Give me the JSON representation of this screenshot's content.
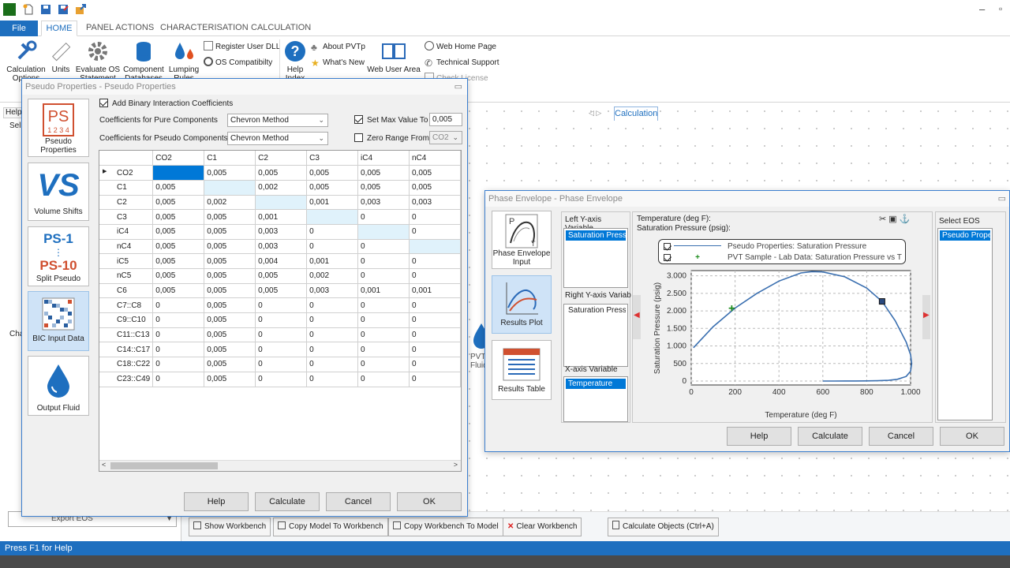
{
  "status_text": "Press F1 for Help",
  "tabs": [
    "File",
    "HOME",
    "PANEL ACTIONS",
    "CHARACTERISATION",
    "CALCULATION"
  ],
  "ribbon": {
    "calc_options": "Calculation Options",
    "units": "Units",
    "evaluate": "Evaluate OS Statement",
    "component_db": "Component Databases",
    "lumping": "Lumping Rules",
    "register_dll": "Register User DLL",
    "os_compat": "OS Compatibilty",
    "help_index": "Help Index",
    "about": "About PVTp",
    "whats_new": "What's New",
    "web_user": "Web User Area",
    "web_home": "Web Home Page",
    "tech_support": "Technical Support",
    "license": "Check License"
  },
  "left_panel": {
    "help_tab": "Help",
    "sel_label": "Sel",
    "cha_label": "Cha",
    "export_eos": "Export EOS"
  },
  "workbench_tab": "Calculation",
  "workbench_buttons": {
    "show": "Show Workbench",
    "copy_model": "Copy Model To Workbench",
    "copy_wb": "Copy Workbench To Model",
    "clear": "Clear Workbench",
    "calc_objects": "Calculate Objects (Ctrl+A)"
  },
  "pseudo_dialog": {
    "title": "Pseudo Properties - Pseudo Properties",
    "sidebar": [
      "Pseudo Properties",
      "Volume Shifts",
      "Split Pseudo",
      "BIC Input Data",
      "Output Fluid"
    ],
    "add_bic": "Add Binary Interaction Coefficients",
    "pure_label": "Coefficients for Pure Components",
    "pure_value": "Chevron Method",
    "pseudo_label": "Coefficients for Pseudo Components",
    "pseudo_value": "Chevron Method",
    "set_max_label": "Set Max Value To",
    "set_max_value": "0,005",
    "zero_range_label": "Zero Range From",
    "zero_range_value": "CO2",
    "columns": [
      "CO2",
      "C1",
      "C2",
      "C3",
      "iC4",
      "nC4"
    ],
    "rows": [
      {
        "name": "CO2",
        "v": [
          "",
          "0,005",
          "0,005",
          "0,005",
          "0,005",
          "0,005"
        ]
      },
      {
        "name": "C1",
        "v": [
          "0,005",
          "",
          "0,002",
          "0,005",
          "0,005",
          "0,005"
        ]
      },
      {
        "name": "C2",
        "v": [
          "0,005",
          "0,002",
          "",
          "0,001",
          "0,003",
          "0,003"
        ]
      },
      {
        "name": "C3",
        "v": [
          "0,005",
          "0,005",
          "0,001",
          "",
          "0",
          "0"
        ]
      },
      {
        "name": "iC4",
        "v": [
          "0,005",
          "0,005",
          "0,003",
          "0",
          "",
          "0"
        ]
      },
      {
        "name": "nC4",
        "v": [
          "0,005",
          "0,005",
          "0,003",
          "0",
          "0",
          ""
        ]
      },
      {
        "name": "iC5",
        "v": [
          "0,005",
          "0,005",
          "0,004",
          "0,001",
          "0",
          "0"
        ]
      },
      {
        "name": "nC5",
        "v": [
          "0,005",
          "0,005",
          "0,005",
          "0,002",
          "0",
          "0"
        ]
      },
      {
        "name": "C6",
        "v": [
          "0,005",
          "0,005",
          "0,005",
          "0,003",
          "0,001",
          "0,001"
        ]
      },
      {
        "name": "C7::C8",
        "v": [
          "0",
          "0,005",
          "0",
          "0",
          "0",
          "0"
        ]
      },
      {
        "name": "C9::C10",
        "v": [
          "0",
          "0,005",
          "0",
          "0",
          "0",
          "0"
        ]
      },
      {
        "name": "C11::C13",
        "v": [
          "0",
          "0,005",
          "0",
          "0",
          "0",
          "0"
        ]
      },
      {
        "name": "C14::C17",
        "v": [
          "0",
          "0,005",
          "0",
          "0",
          "0",
          "0"
        ]
      },
      {
        "name": "C18::C22",
        "v": [
          "0",
          "0,005",
          "0",
          "0",
          "0",
          "0"
        ]
      },
      {
        "name": "C23::C49",
        "v": [
          "0",
          "0,005",
          "0",
          "0",
          "0",
          "0"
        ]
      }
    ],
    "buttons": [
      "Help",
      "Calculate",
      "Cancel",
      "OK"
    ]
  },
  "phase_dialog": {
    "title": "Phase Envelope - Phase Envelope",
    "sidebar": [
      "Phase Envelope Input",
      "Results Plot",
      "Results Table"
    ],
    "left_y_label": "Left Y-axis Variable",
    "left_y_item": "Saturation Pressure",
    "right_y_label": "Right Y-axis Variable",
    "right_y_item": "Saturation Pressure",
    "x_label": "X-axis Variable",
    "x_item": "Temperature",
    "readout1": "Temperature (deg F):",
    "readout2": "Saturation Pressure (psig):",
    "legend1": "Pseudo Properties: Saturation Pressure",
    "legend2": "PVT Sample - Lab Data: Saturation Pressure vs T",
    "eos_label": "Select EOS",
    "eos_item": "Pseudo Properties",
    "buttons": [
      "Help",
      "Calculate",
      "Cancel",
      "OK"
    ],
    "node_label": "PVT Fluid"
  },
  "chart_data": {
    "type": "line",
    "xlabel": "Temperature (deg F)",
    "ylabel": "Saturation Pressure (psig)",
    "xlim": [
      0,
      1000
    ],
    "ylim": [
      0,
      3000
    ],
    "xticks": [
      "0",
      "200",
      "400",
      "600",
      "800",
      "1.000"
    ],
    "yticks": [
      "0",
      "500",
      "1.000",
      "1.500",
      "2.000",
      "2.500",
      "3.000"
    ],
    "grid": true,
    "series": [
      {
        "name": "Pseudo Properties: Saturation Pressure",
        "color": "#3a6fb0",
        "x": [
          10,
          100,
          200,
          300,
          400,
          500,
          550,
          600,
          700,
          800,
          870,
          930,
          980,
          1000,
          1005,
          1000,
          980,
          940,
          900,
          850,
          800,
          750,
          700,
          650,
          600
        ],
        "y": [
          950,
          1550,
          2080,
          2500,
          2850,
          3080,
          3120,
          3110,
          2970,
          2650,
          2270,
          1720,
          1110,
          750,
          500,
          280,
          130,
          50,
          20,
          8,
          5,
          3,
          2,
          1,
          0
        ]
      },
      {
        "name": "PVT Sample - Lab Data: Saturation Pressure vs T",
        "color": "#1a8a1a",
        "x": [
          185
        ],
        "y": [
          2080
        ]
      }
    ],
    "marker": {
      "x": 870,
      "y": 2270
    }
  }
}
